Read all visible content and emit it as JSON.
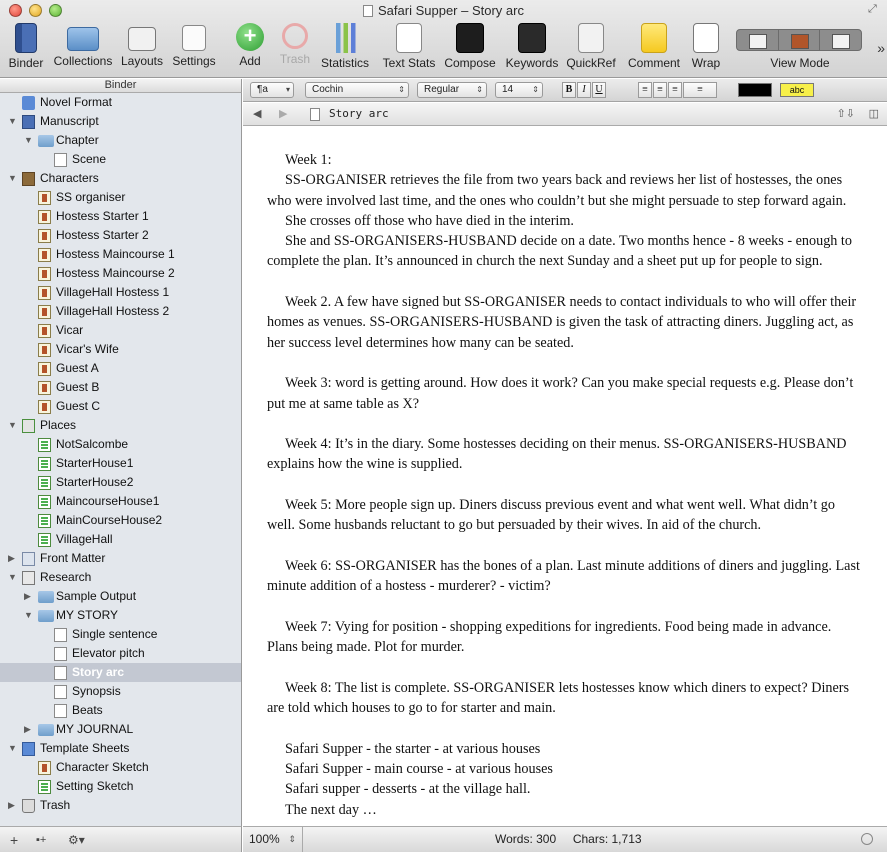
{
  "window": {
    "title": "Safari Supper – Story arc"
  },
  "toolbar": {
    "items": [
      {
        "label": "Binder"
      },
      {
        "label": "Collections"
      },
      {
        "label": "Layouts"
      },
      {
        "label": "Settings"
      },
      {
        "label": "Add"
      },
      {
        "label": "Trash"
      },
      {
        "label": "Statistics"
      },
      {
        "label": "Text Stats"
      },
      {
        "label": "Compose"
      },
      {
        "label": "Keywords"
      },
      {
        "label": "QuickRef"
      },
      {
        "label": "Comment"
      },
      {
        "label": "Wrap"
      },
      {
        "label": "View Mode"
      }
    ]
  },
  "binder": {
    "header": "Binder",
    "items": [
      {
        "label": "Novel Format",
        "level": 0,
        "arrow": "",
        "icon": "novel-format-icon"
      },
      {
        "label": "Manuscript",
        "level": 0,
        "arrow": "▼",
        "icon": "manuscript-icon"
      },
      {
        "label": "Chapter",
        "level": 1,
        "arrow": "▼",
        "icon": "folder-icon"
      },
      {
        "label": "Scene",
        "level": 2,
        "arrow": "",
        "icon": "document-icon"
      },
      {
        "label": "Characters",
        "level": 0,
        "arrow": "▼",
        "icon": "characters-folder-icon"
      },
      {
        "label": "SS organiser",
        "level": 1,
        "arrow": "",
        "icon": "character-sheet-icon"
      },
      {
        "label": "Hostess Starter 1",
        "level": 1,
        "arrow": "",
        "icon": "character-sheet-icon"
      },
      {
        "label": "Hostess Starter 2",
        "level": 1,
        "arrow": "",
        "icon": "character-sheet-icon"
      },
      {
        "label": "Hostess Maincourse 1",
        "level": 1,
        "arrow": "",
        "icon": "character-sheet-icon"
      },
      {
        "label": "Hostess Maincourse 2",
        "level": 1,
        "arrow": "",
        "icon": "character-sheet-icon"
      },
      {
        "label": "VillageHall Hostess 1",
        "level": 1,
        "arrow": "",
        "icon": "character-sheet-icon"
      },
      {
        "label": "VillageHall Hostess 2",
        "level": 1,
        "arrow": "",
        "icon": "character-sheet-icon"
      },
      {
        "label": "Vicar",
        "level": 1,
        "arrow": "",
        "icon": "character-sheet-icon"
      },
      {
        "label": "Vicar's Wife",
        "level": 1,
        "arrow": "",
        "icon": "character-sheet-icon"
      },
      {
        "label": "Guest A",
        "level": 1,
        "arrow": "",
        "icon": "character-sheet-icon"
      },
      {
        "label": "Guest B",
        "level": 1,
        "arrow": "",
        "icon": "character-sheet-icon"
      },
      {
        "label": "Guest C",
        "level": 1,
        "arrow": "",
        "icon": "character-sheet-icon"
      },
      {
        "label": "Places",
        "level": 0,
        "arrow": "▼",
        "icon": "places-folder-icon"
      },
      {
        "label": "NotSalcombe",
        "level": 1,
        "arrow": "",
        "icon": "place-sheet-icon"
      },
      {
        "label": "StarterHouse1",
        "level": 1,
        "arrow": "",
        "icon": "place-sheet-icon"
      },
      {
        "label": "StarterHouse2",
        "level": 1,
        "arrow": "",
        "icon": "place-sheet-icon"
      },
      {
        "label": "MaincourseHouse1",
        "level": 1,
        "arrow": "",
        "icon": "place-sheet-icon"
      },
      {
        "label": "MainCourseHouse2",
        "level": 1,
        "arrow": "",
        "icon": "place-sheet-icon"
      },
      {
        "label": "VillageHall",
        "level": 1,
        "arrow": "",
        "icon": "place-sheet-icon"
      },
      {
        "label": "Front Matter",
        "level": 0,
        "arrow": "▶",
        "icon": "front-matter-icon"
      },
      {
        "label": "Research",
        "level": 0,
        "arrow": "▼",
        "icon": "research-icon"
      },
      {
        "label": "Sample Output",
        "level": 1,
        "arrow": "▶",
        "icon": "folder-icon"
      },
      {
        "label": "MY STORY",
        "level": 1,
        "arrow": "▼",
        "icon": "folder-icon"
      },
      {
        "label": "Single sentence",
        "level": 2,
        "arrow": "",
        "icon": "text-document-icon"
      },
      {
        "label": "Elevator pitch",
        "level": 2,
        "arrow": "",
        "icon": "text-document-icon"
      },
      {
        "label": "Story arc",
        "level": 2,
        "arrow": "",
        "icon": "text-document-icon",
        "selected": true
      },
      {
        "label": "Synopsis",
        "level": 2,
        "arrow": "",
        "icon": "document-icon"
      },
      {
        "label": "Beats",
        "level": 2,
        "arrow": "",
        "icon": "document-icon"
      },
      {
        "label": "MY JOURNAL",
        "level": 1,
        "arrow": "▶",
        "icon": "folder-icon"
      },
      {
        "label": "Template Sheets",
        "level": 0,
        "arrow": "▼",
        "icon": "template-sheets-icon"
      },
      {
        "label": "Character Sketch",
        "level": 1,
        "arrow": "",
        "icon": "character-sketch-icon"
      },
      {
        "label": "Setting Sketch",
        "level": 1,
        "arrow": "",
        "icon": "setting-sketch-icon"
      },
      {
        "label": "Trash",
        "level": 0,
        "arrow": "▶",
        "icon": "trash-icon"
      }
    ],
    "footer": {
      "add": "+",
      "add_folder": "▪+",
      "gear": "⚙▾"
    }
  },
  "formatbar": {
    "style": "¶a",
    "font": "Cochin",
    "typeface": "Regular",
    "size": "14",
    "bold": "B",
    "italic": "I",
    "underline": "U",
    "highlight_label": "abc",
    "text_color": "#000000",
    "highlight_color": "#f7f04a"
  },
  "editor": {
    "doc_title": "Story arc",
    "paragraphs": [
      "Week 1:",
      "SS-ORGANISER retrieves the file from two years back and reviews her list of hostesses, the ones who were involved last time, and the ones who couldn’t but she might persuade to step forward again.",
      "She crosses off those who have died in the interim.",
      "She and SS-ORGANISERS-HUSBAND decide on a date. Two months hence - 8 weeks - enough to complete the plan. It’s announced in church the next Sunday and a sheet put up for people to sign.",
      "",
      "Week 2. A few have signed but SS-ORGANISER needs to contact individuals to who will offer their homes as venues. SS-ORGANISERS-HUSBAND is given the task of attracting diners. Juggling act, as her success level determines how many can be seated.",
      "",
      "Week 3: word is getting around. How does it work? Can you make special requests e.g. Please don’t put me at same table as X?",
      "",
      "Week 4: It’s in the diary. Some hostesses deciding on their menus. SS-ORGANISERS-HUSBAND explains how the wine is supplied.",
      "",
      "Week 5: More people sign up. Diners discuss previous event and what went well. What didn’t go well. Some husbands reluctant to go but persuaded by their wives. In aid of the church.",
      "",
      "Week 6: SS-ORGANISER has the bones of a plan. Last minute additions of diners and juggling. Last minute addition of a hostess - murderer? - victim?",
      "",
      "Week 7: Vying for position - shopping expeditions for ingredients. Food being made in advance. Plans being made. Plot for murder.",
      "",
      "Week 8: The list is complete. SS-ORGANISER lets hostesses know which diners to expect? Diners are told which houses to go to for starter and main.",
      "",
      "Safari Supper - the starter - at various houses",
      "Safari Supper - main course - at various houses",
      "Safari supper - desserts - at the village hall.",
      "The next day …"
    ]
  },
  "status": {
    "zoom": "100%",
    "words": "Words: 300",
    "chars": "Chars: 1,713"
  }
}
